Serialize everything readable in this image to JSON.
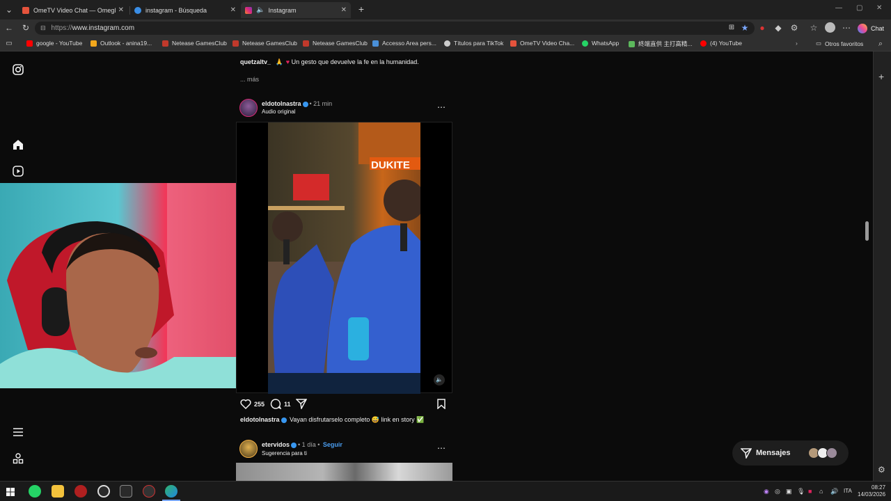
{
  "tabs": [
    {
      "title": "OmeTV Video Chat — Omegle Ra",
      "favicon_color": "#e5533c"
    },
    {
      "title": "instagram - Búsqueda",
      "favicon_color": "#3a8ee6"
    },
    {
      "title": "Instagram",
      "favicon_color": "#d62976"
    }
  ],
  "address": {
    "protocol": "https://",
    "host": "www.instagram.com"
  },
  "chat_label": "Chat",
  "bookmarks": [
    {
      "label": "google - YouTube",
      "color": "#ff0000"
    },
    {
      "label": "Outlook - anina19...",
      "color": "#f3a81c"
    },
    {
      "label": "Netease GamesClub",
      "color": "#c0392b"
    },
    {
      "label": "Netease GamesClub",
      "color": "#c0392b"
    },
    {
      "label": "Netease GamesClub",
      "color": "#c0392b"
    },
    {
      "label": "Accesso Area pers...",
      "color": "#4a90d9"
    },
    {
      "label": "Títulos para TikTok",
      "color": "#cccccc"
    },
    {
      "label": "OmeTV Video Cha...",
      "color": "#e5533c"
    },
    {
      "label": "WhatsApp",
      "color": "#25d366"
    },
    {
      "label": "終端直供 主打高精...",
      "color": "#5cb85c"
    },
    {
      "label": "(4) YouTube",
      "color": "#ff0000"
    }
  ],
  "bookmarks_other": "Otros favoritos",
  "feed": {
    "prev_caption": {
      "user": "quetzaltv_",
      "text": "Un gesto que devuelve la fe en la humanidad.",
      "more": "... más"
    },
    "post": {
      "user": "eldotolnastra",
      "time": "• 21 min",
      "audio": "Audio original",
      "video_overlay": "DUKITE",
      "likes": "255",
      "comments": "11",
      "caption_user": "eldotolnastra",
      "caption_text": "Vayan disfrutarselo completo 😅 link en story ✅"
    },
    "next": {
      "user": "etervidos",
      "time": "• 1 día •",
      "follow": "Seguir",
      "sub": "Sugerencia para ti"
    }
  },
  "messages_label": "Mensajes",
  "clock": {
    "time": "08:27",
    "date": "14/03/2026"
  },
  "lang": "ITA"
}
